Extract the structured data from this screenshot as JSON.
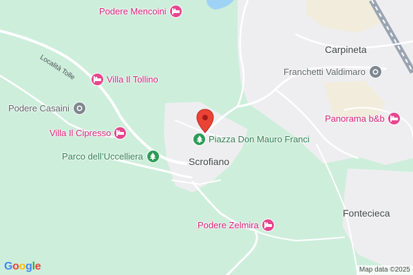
{
  "map": {
    "center_marker_icon": "red-location-pin-icon",
    "colors": {
      "land": "#cdeedb",
      "built_up": "#eeeef0",
      "roads": "#ffffff",
      "water": "#9fd3f5",
      "railway_bg": "#9aa4b1",
      "hotel_accent": "#e8458e",
      "park_accent": "#2d9c57",
      "generic_accent": "#7e868f",
      "marker": "#ea4335"
    },
    "pois": [
      {
        "label": "Podere Mencoini",
        "category": "hotel",
        "icon": "hotel-bed-icon"
      },
      {
        "label": "Villa Il Tollino",
        "category": "hotel",
        "icon": "hotel-bed-icon"
      },
      {
        "label": "Podere Casaini",
        "category": "generic",
        "icon": "place-dot-icon"
      },
      {
        "label": "Villa Il Cipresso",
        "category": "hotel",
        "icon": "hotel-bed-icon"
      },
      {
        "label": "Parco dell’Uccelliera",
        "category": "park",
        "icon": "tree-icon"
      },
      {
        "label": "Piazza Don Mauro Franci",
        "category": "park",
        "icon": "tree-icon"
      },
      {
        "label": "Franchetti Valdimaro",
        "category": "generic",
        "icon": "place-dot-icon"
      },
      {
        "label": "Panorama b&b",
        "category": "hotel",
        "icon": "hotel-bed-icon"
      },
      {
        "label": "Podere Zelmira",
        "category": "hotel",
        "icon": "hotel-bed-icon"
      }
    ],
    "places": [
      {
        "label": "Carpineta"
      },
      {
        "label": "Scrofiano"
      },
      {
        "label": "Fontecieca"
      }
    ],
    "roads": [
      {
        "label": "Località Tolle"
      }
    ],
    "logo": {
      "text": "Google",
      "letters": [
        "G",
        "o",
        "o",
        "g",
        "l",
        "e"
      ],
      "letter_colors": [
        "#4285F4",
        "#EA4335",
        "#FBBC05",
        "#4285F4",
        "#34A853",
        "#EA4335"
      ]
    },
    "attribution": "Map data ©2025"
  }
}
